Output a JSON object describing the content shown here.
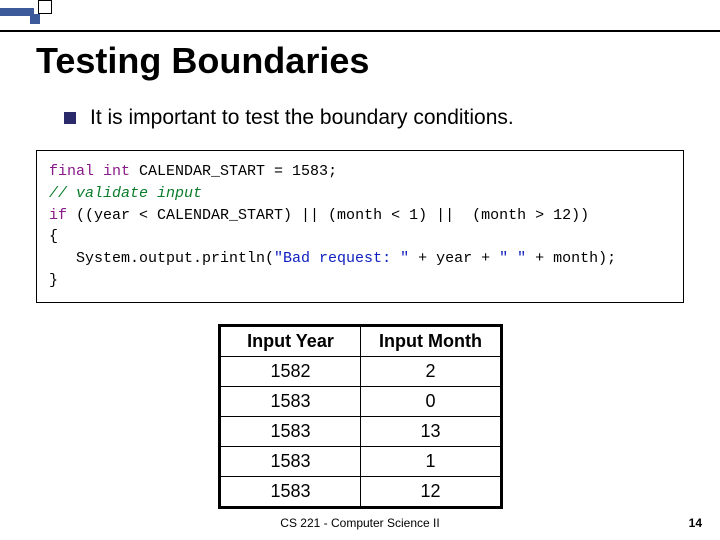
{
  "title": "Testing Boundaries",
  "bullet": "It is important to test the boundary conditions.",
  "code": {
    "l1a": "final",
    "l1b": " int",
    "l1c": " CALENDAR_START = 1583;",
    "l2": "// validate input",
    "l3a": "if",
    "l3b": " ((year < CALENDAR_START) || (month < 1) ||  (month > 12))",
    "l4": "{",
    "l5a": "   System.output.println(",
    "l5b": "\"Bad request: \"",
    "l5c": " + year + ",
    "l5d": "\" \"",
    "l5e": " + month);",
    "l6": "}"
  },
  "table": {
    "headers": {
      "year": "Input Year",
      "month": "Input Month"
    },
    "rows": [
      {
        "year": "1582",
        "month": "2"
      },
      {
        "year": "1583",
        "month": "0"
      },
      {
        "year": "1583",
        "month": "13"
      },
      {
        "year": "1583",
        "month": "1"
      },
      {
        "year": "1583",
        "month": "12"
      }
    ]
  },
  "footer": "CS 221 - Computer Science II",
  "page": "14",
  "chart_data": {
    "type": "table",
    "title": "Testing Boundaries",
    "columns": [
      "Input Year",
      "Input Month"
    ],
    "rows": [
      [
        1582,
        2
      ],
      [
        1583,
        0
      ],
      [
        1583,
        13
      ],
      [
        1583,
        1
      ],
      [
        1583,
        12
      ]
    ]
  }
}
